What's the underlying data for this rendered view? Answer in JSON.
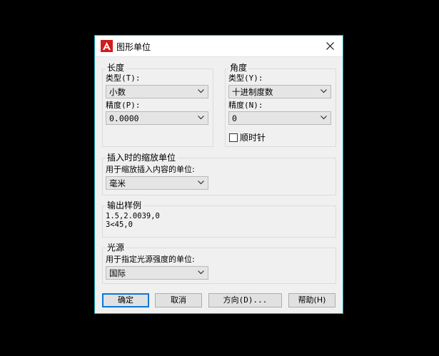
{
  "dialog": {
    "title": "图形单位",
    "app_icon": "autocad-logo-icon",
    "accent": "#17a9b5"
  },
  "length": {
    "group_label": "长度",
    "type_label": "类型(T):",
    "type_value": "小数",
    "precision_label": "精度(P):",
    "precision_value": "0.0000"
  },
  "angle": {
    "group_label": "角度",
    "type_label": "类型(Y):",
    "type_value": "十进制度数",
    "precision_label": "精度(N):",
    "precision_value": "0",
    "clockwise_label": "顺时针",
    "clockwise_checked": false
  },
  "insertion": {
    "group_label": "插入时的缩放单位",
    "desc": "用于缩放插入内容的单位:",
    "value": "毫米"
  },
  "sample_output": {
    "group_label": "输出样例",
    "line1": "1.5,2.0039,0",
    "line2": "3<45,0"
  },
  "lighting": {
    "group_label": "光源",
    "desc": "用于指定光源强度的单位:",
    "value": "国际"
  },
  "buttons": {
    "ok": "确定",
    "cancel": "取消",
    "direction": "方向(D)...",
    "help": "帮助(H)"
  }
}
